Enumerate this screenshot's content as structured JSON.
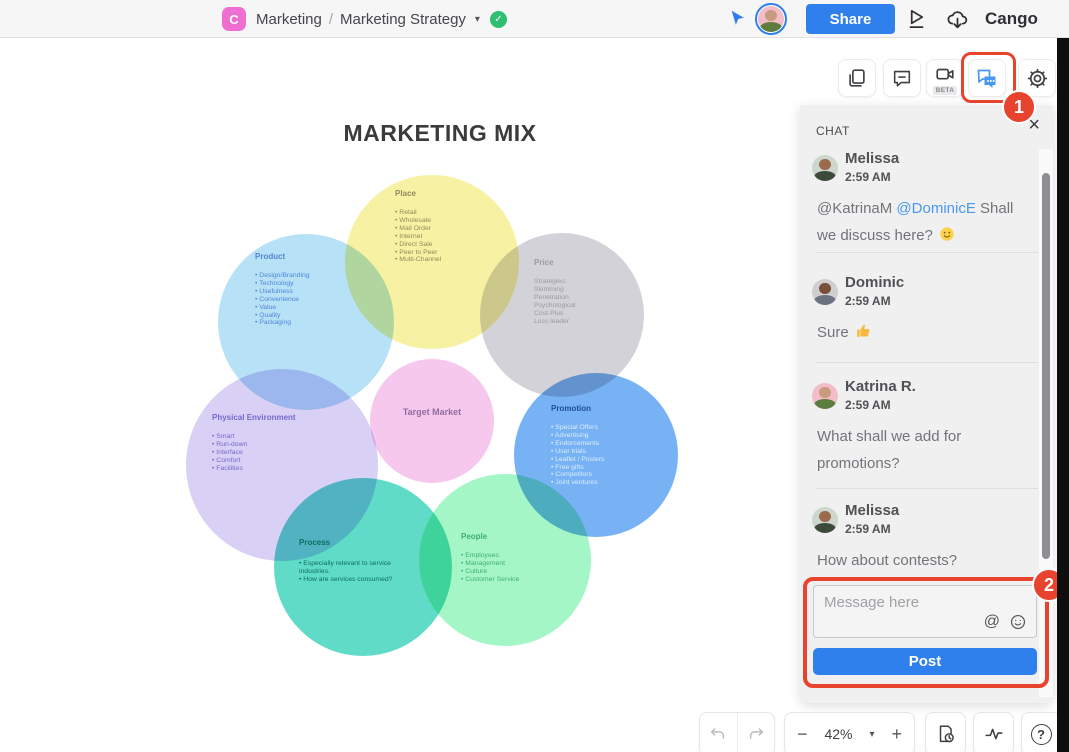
{
  "header": {
    "logo_letter": "C",
    "breadcrumb": {
      "folder": "Marketing",
      "separator": "/",
      "document": "Marketing Strategy"
    },
    "share_label": "Share",
    "brand": "Cango"
  },
  "top_toolbar": {
    "beta_label": "BETA",
    "annotation_badge_1": "1",
    "icons": [
      "pages-icon",
      "comment-icon",
      "video-camera-icon",
      "chat-icon",
      "gear-icon"
    ]
  },
  "chat": {
    "title": "CHAT",
    "messages": [
      {
        "name": "Melissa",
        "time": "2:59 AM",
        "text_pre": "@KatrinaM ",
        "mention": "@DominicE",
        "text_post": " Shall we discuss here?",
        "emoji": "slightly-smiling-face"
      },
      {
        "name": "Dominic",
        "time": "2:59 AM",
        "text": "Sure",
        "emoji": "thumbs-up"
      },
      {
        "name": "Katrina R.",
        "time": "2:59 AM",
        "text": "What shall we add for promotions?"
      },
      {
        "name": "Melissa",
        "time": "2:59 AM",
        "text": "How about contests?"
      }
    ],
    "input_placeholder": "Message here",
    "post_label": "Post",
    "annotation_badge_2": "2"
  },
  "canvas": {
    "title": "MARKETING MIX",
    "diagram": {
      "center_label": "Target Market",
      "circles": [
        {
          "label": "Place",
          "color": "#f7f2a3",
          "items": [
            "Retail",
            "Wholesale",
            "Mail Order",
            "Internet",
            "Direct Sale",
            "Peer to Peer",
            "Multi-Channel"
          ]
        },
        {
          "label": "Product",
          "color": "#b7e1f7",
          "items": [
            "Design/Branding",
            "Technology",
            "Usefulness",
            "Convenience",
            "Value",
            "Quality",
            "Packaging"
          ]
        },
        {
          "label": "Price",
          "color": "#d3d2d9",
          "items": [
            "Strategies:",
            "Skimming",
            "Penetration",
            "Psychological",
            "Cost-Plus",
            "Loss leader"
          ]
        },
        {
          "label": "Physical Environment",
          "color": "#d9d0f6",
          "items": [
            "Smart",
            "Run-down",
            "Interface",
            "Comfort",
            "Facilities"
          ]
        },
        {
          "label": "Promotion",
          "color": "#77b2f4",
          "items": [
            "Special Offers",
            "Advertising",
            "Endorsements",
            "User trials",
            "Leaflet / Posters",
            "Free gifts",
            "Competitors",
            "Joint ventures"
          ]
        },
        {
          "label": "Process",
          "color": "#5fdbc8",
          "items": [
            "Especially relevant to service industries.",
            "How are services consumed?"
          ]
        },
        {
          "label": "People",
          "color": "#a5f6c6",
          "items": [
            "Employees",
            "Management",
            "Culture",
            "Customer Service"
          ]
        }
      ]
    }
  },
  "bottom_bar": {
    "zoom_level": "42%"
  },
  "glyphs": {
    "caret": "▾",
    "close": "×",
    "check": "✓",
    "at": "@",
    "minus": "−",
    "plus": "+",
    "question": "?"
  },
  "colors": {
    "accent_blue": "#2f80ed",
    "annotation_red": "#e8432e",
    "logo_pink": "#ee6ed2",
    "check_green": "#2fbf71",
    "mention_blue": "#4a97ef"
  }
}
